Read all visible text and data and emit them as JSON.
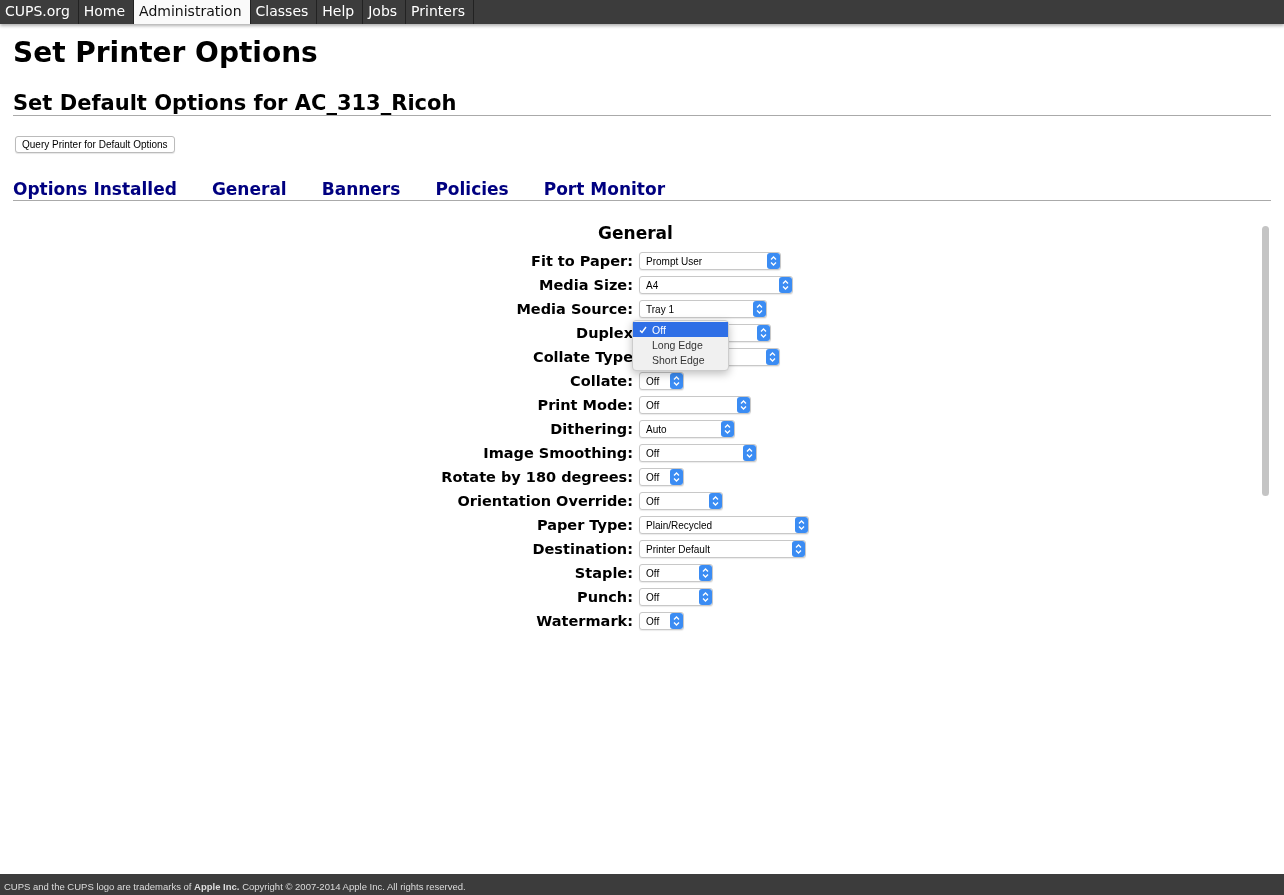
{
  "nav": [
    {
      "label": "CUPS.org",
      "selected": false
    },
    {
      "label": "Home",
      "selected": false
    },
    {
      "label": "Administration",
      "selected": true
    },
    {
      "label": "Classes",
      "selected": false
    },
    {
      "label": "Help",
      "selected": false
    },
    {
      "label": "Jobs",
      "selected": false
    },
    {
      "label": "Printers",
      "selected": false
    }
  ],
  "page_title": "Set Printer Options",
  "section_title": "Set Default Options for AC_313_Ricoh",
  "query_button": "Query Printer for Default Options",
  "option_tabs": [
    "Options Installed",
    "General",
    "Banners",
    "Policies",
    "Port Monitor"
  ],
  "group_title": "General",
  "options": [
    {
      "label": "Fit to Paper:",
      "value": "Prompt User"
    },
    {
      "label": "Media Size:",
      "value": "A4"
    },
    {
      "label": "Media Source:",
      "value": "Tray 1"
    },
    {
      "label": "Duplex",
      "open": true,
      "menu": [
        {
          "label": "Off",
          "selected": true
        },
        {
          "label": "Long Edge",
          "selected": false
        },
        {
          "label": "Short Edge",
          "selected": false
        }
      ]
    },
    {
      "label": "Collate Type"
    },
    {
      "label": "Collate:",
      "value": "Off"
    },
    {
      "label": "Print Mode:",
      "value": "Off"
    },
    {
      "label": "Dithering:",
      "value": "Auto"
    },
    {
      "label": "Image Smoothing:",
      "value": "Off"
    },
    {
      "label": "Rotate by 180 degrees:",
      "value": "Off"
    },
    {
      "label": "Orientation Override:",
      "value": "Off"
    },
    {
      "label": "Paper Type:",
      "value": "Plain/Recycled"
    },
    {
      "label": "Destination:",
      "value": "Printer Default"
    },
    {
      "label": "Staple:",
      "value": "Off"
    },
    {
      "label": "Punch:",
      "value": "Off"
    },
    {
      "label": "Watermark:",
      "value": "Off"
    }
  ],
  "footer": "CUPS and the CUPS logo are trademarks of **Apple Inc.** Copyright © 2007-2014 Apple Inc. All rights reserved."
}
